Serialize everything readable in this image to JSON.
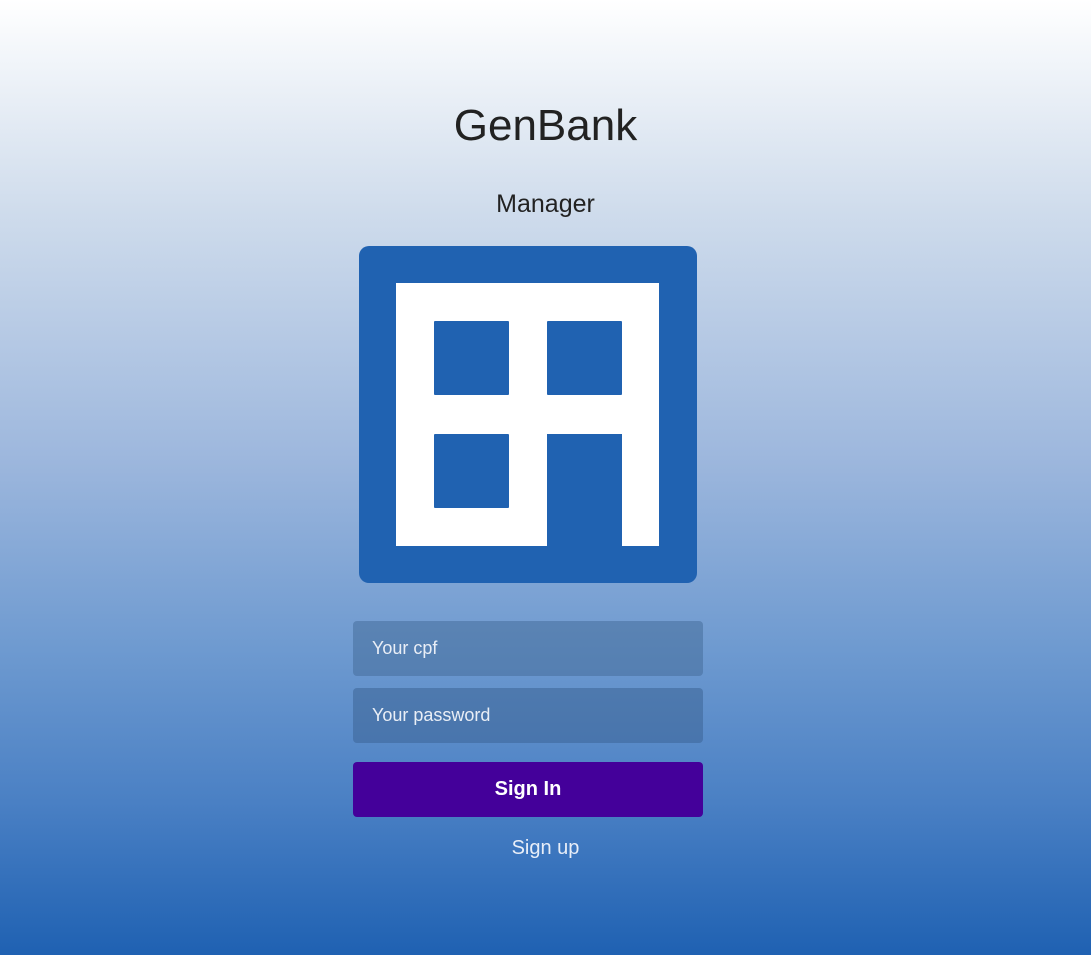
{
  "app": {
    "title": "GenBank",
    "subtitle": "Manager"
  },
  "logo": {
    "icon": "bank-logo-icon",
    "color": "#2062b1"
  },
  "form": {
    "cpf_placeholder": "Your cpf",
    "password_placeholder": "Your password",
    "sign_in_label": "Sign In",
    "sign_up_label": "Sign up"
  },
  "colors": {
    "primary_button": "#44009a",
    "brand_blue": "#2062b1"
  }
}
